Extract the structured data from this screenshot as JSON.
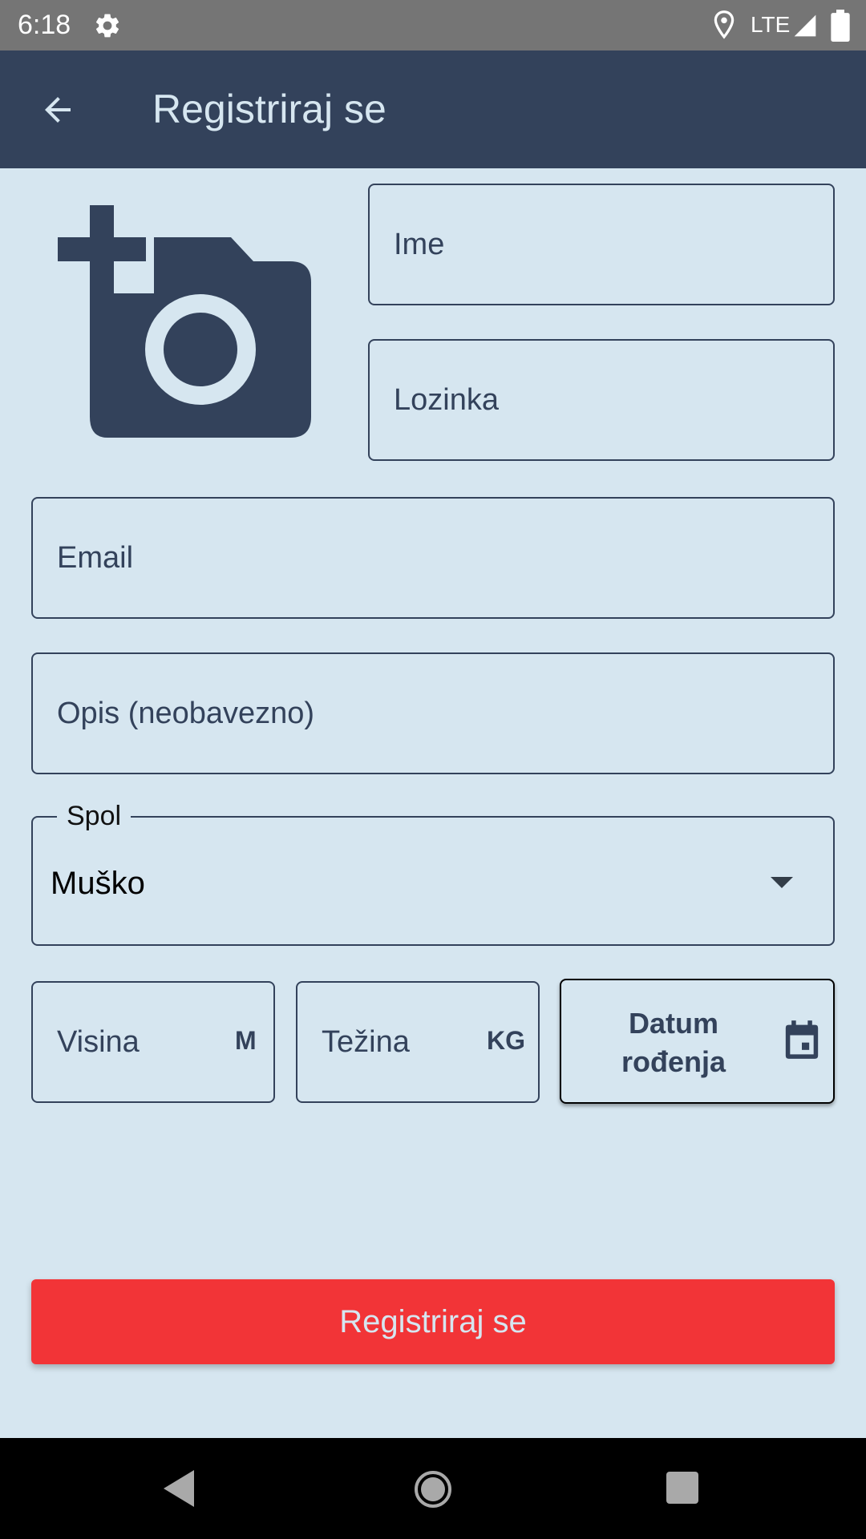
{
  "status_bar": {
    "time": "6:18",
    "network": "LTE",
    "icons": [
      "gear-icon",
      "location-icon",
      "signal-icon",
      "battery-icon"
    ]
  },
  "app_bar": {
    "title": "Registriraj se",
    "back_icon": "arrow-left-icon"
  },
  "photo": {
    "icon": "add-photo-camera-icon"
  },
  "form": {
    "ime": {
      "placeholder": "Ime",
      "value": ""
    },
    "lozinka": {
      "placeholder": "Lozinka",
      "value": ""
    },
    "email": {
      "placeholder": "Email",
      "value": ""
    },
    "opis": {
      "placeholder": "Opis (neobavezno)",
      "value": ""
    },
    "spol": {
      "label": "Spol",
      "selected": "Muško"
    },
    "visina": {
      "placeholder": "Visina",
      "unit": "M"
    },
    "tezina": {
      "placeholder": "Težina",
      "unit": "KG"
    },
    "datum": {
      "label": "Datum rođenja",
      "icon": "calendar-icon"
    }
  },
  "submit": {
    "label": "Registriraj se"
  },
  "colors": {
    "background": "#d6e6f0",
    "primary": "#33425b",
    "accent": "#f23437",
    "status_bar": "#757575"
  },
  "nav_bar": {
    "icons": [
      "nav-back-icon",
      "nav-home-icon",
      "nav-recents-icon"
    ]
  }
}
